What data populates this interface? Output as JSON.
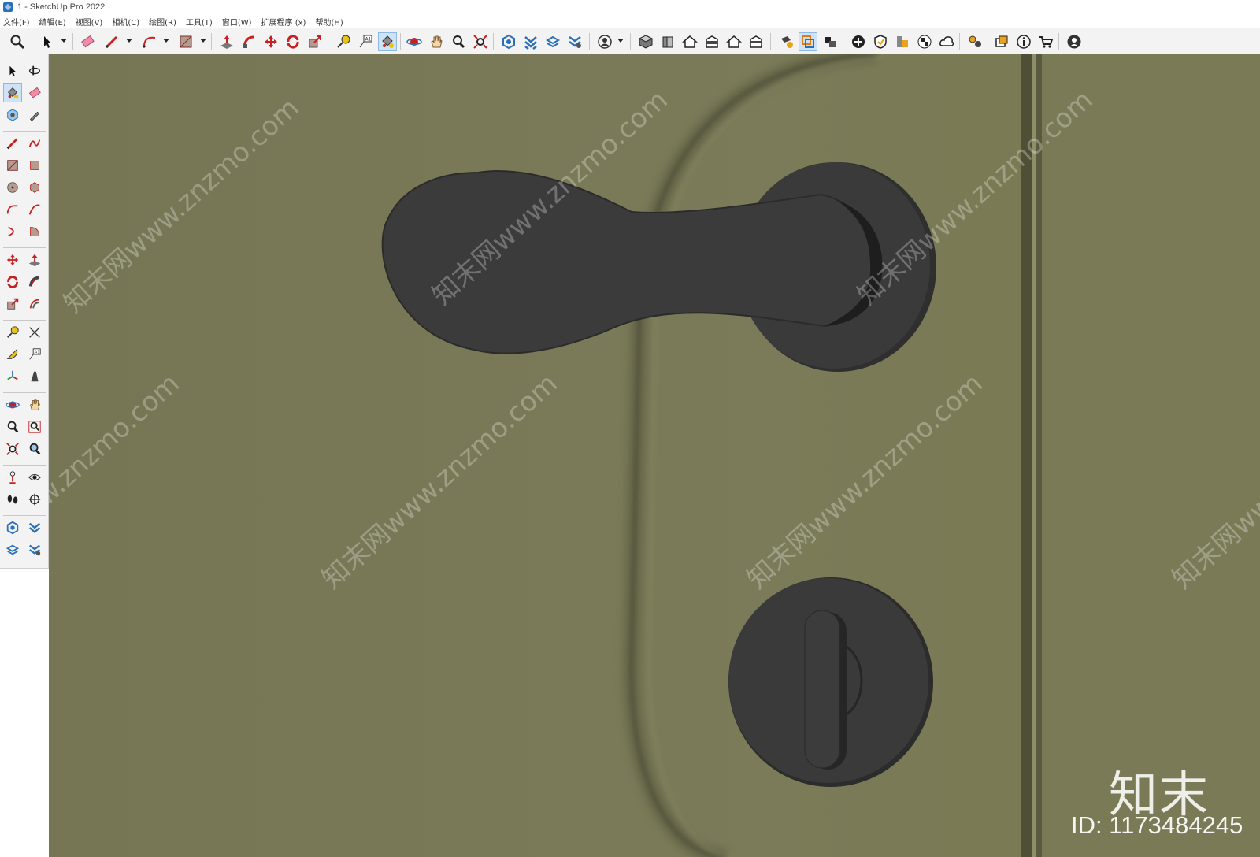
{
  "window": {
    "title": "1 - SketchUp Pro 2022"
  },
  "menu": [
    {
      "label": "文件(F)"
    },
    {
      "label": "编辑(E)"
    },
    {
      "label": "视图(V)"
    },
    {
      "label": "相机(C)"
    },
    {
      "label": "绘图(R)"
    },
    {
      "label": "工具(T)"
    },
    {
      "label": "窗口(W)"
    },
    {
      "label": "扩展程序 (x)"
    },
    {
      "label": "帮助(H)"
    }
  ],
  "toolbar_top": {
    "icons": [
      "zoom-icon",
      "select-icon",
      "eraser-icon",
      "pencil-icon",
      "arc-icon",
      "rectangle-icon",
      "push-pull-icon",
      "follow-me-icon",
      "move-icon",
      "rotate-icon",
      "scale-icon",
      "tape-measure-icon",
      "text-icon",
      "paint-bucket-icon",
      "orbit-icon",
      "pan-icon",
      "zoom-window-icon",
      "zoom-extents-icon",
      "3d-warehouse-icon",
      "extension-warehouse-icon",
      "layout-icon",
      "extension-manager-icon",
      "user-icon",
      "iso-view-icon",
      "front-view-icon",
      "top-view-icon",
      "right-view-icon",
      "back-view-icon",
      "left-view-icon",
      "section-plane-icon",
      "section-display-icon",
      "section-cut-icon",
      "add-location-icon",
      "shield-icon",
      "trimble-connect-icon",
      "checker-icon",
      "cloud-icon",
      "settings-icon",
      "dialog-icon",
      "info-icon",
      "cart-icon",
      "account-icon"
    ],
    "active": "section-display-icon"
  },
  "toolbar_left": {
    "active": "paint-bucket-tool"
  },
  "watermark": {
    "text": "知末网www.znzmo.com",
    "logo": "知末",
    "id_label": "ID: 1173484245"
  },
  "colors": {
    "viewport_bg": "#7a7a58",
    "hardware": "#3a3a3a",
    "accent_red": "#d32020",
    "accent_blue": "#2a6fb8"
  }
}
